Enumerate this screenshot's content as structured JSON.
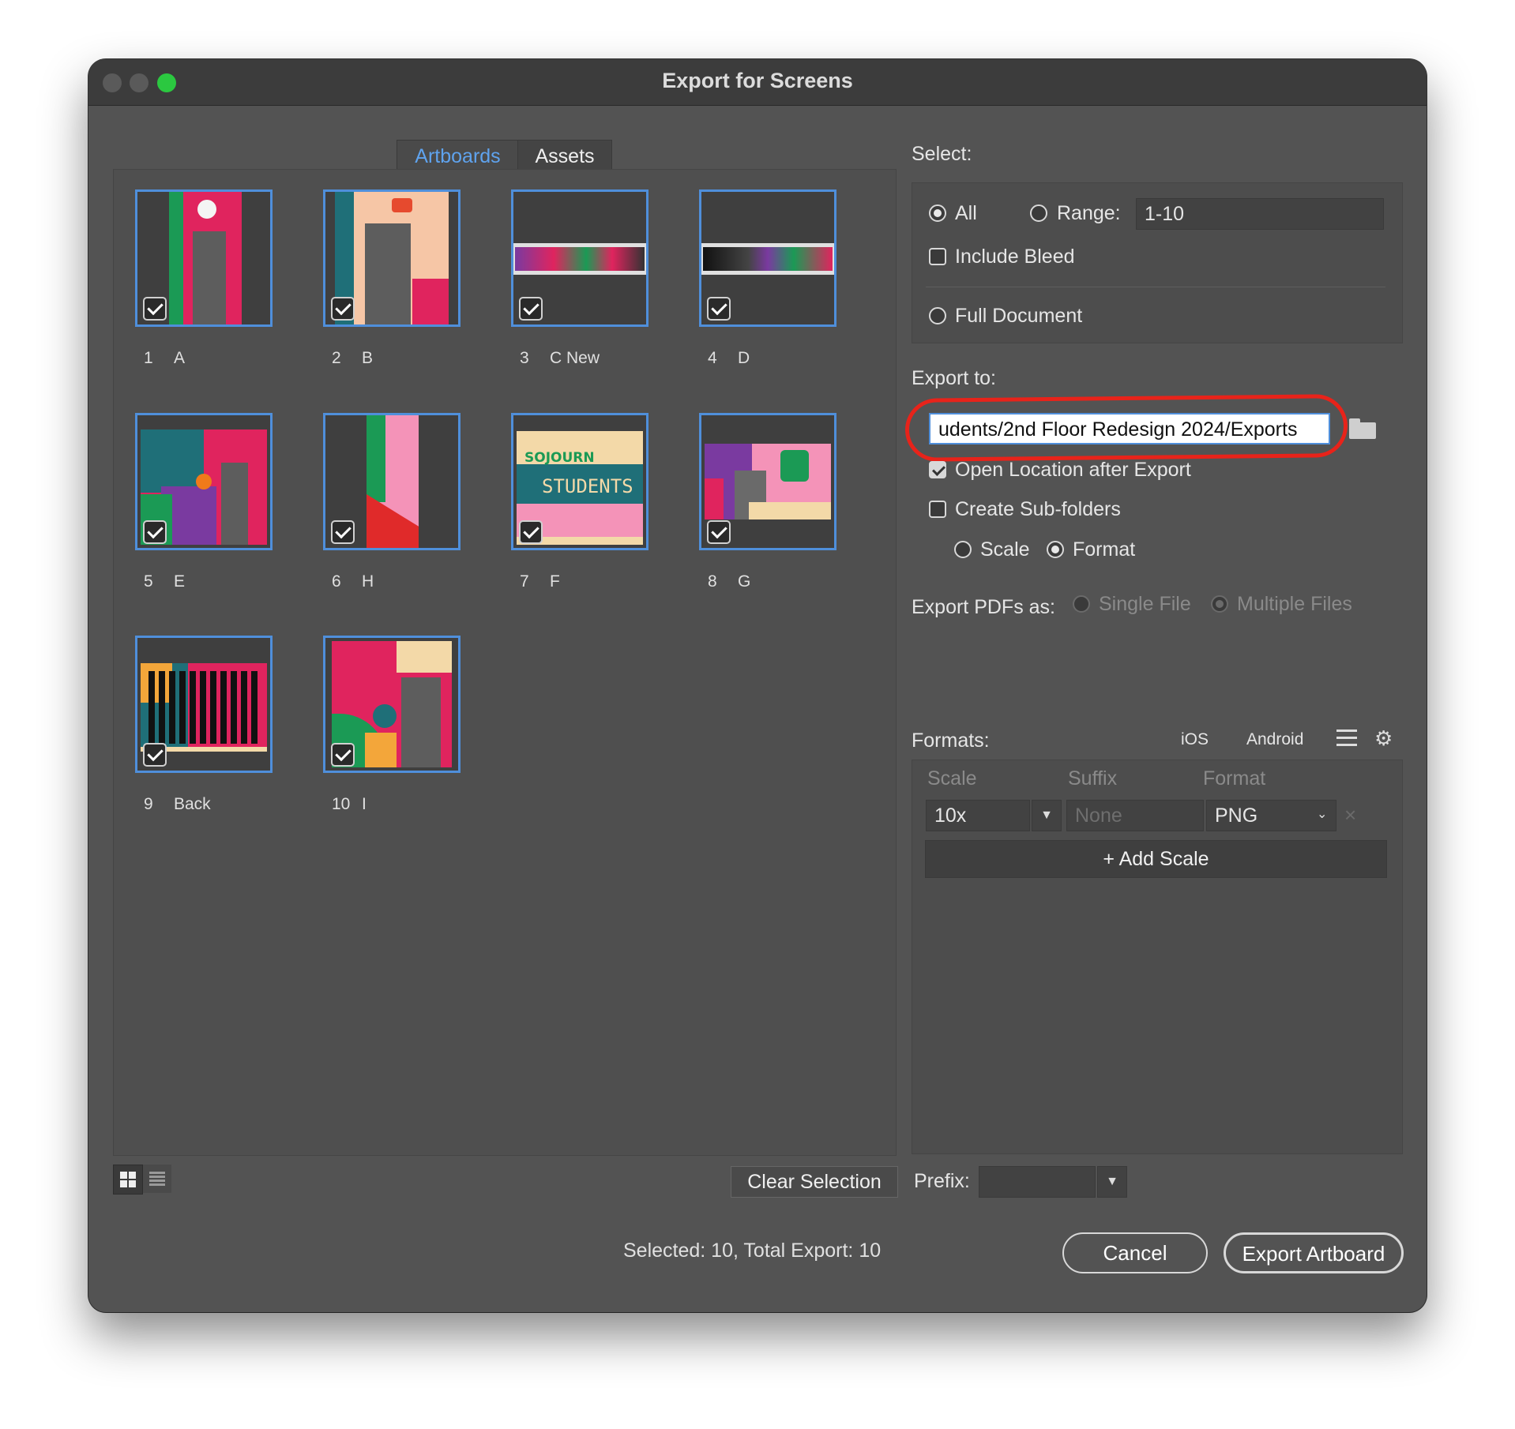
{
  "window": {
    "title": "Export for Screens",
    "traffic_lights": [
      "#5a5a5a",
      "#5a5a5a",
      "#2bc840"
    ]
  },
  "tabs": {
    "artboards": "Artboards",
    "assets": "Assets"
  },
  "artboards": [
    {
      "num": "1",
      "name": "A"
    },
    {
      "num": "2",
      "name": "B"
    },
    {
      "num": "3",
      "name": "C New"
    },
    {
      "num": "4",
      "name": "D"
    },
    {
      "num": "5",
      "name": "E"
    },
    {
      "num": "6",
      "name": "H"
    },
    {
      "num": "7",
      "name": "F",
      "art_text_1": "SOJOURN",
      "art_text_2": "STUDENTS"
    },
    {
      "num": "8",
      "name": "G"
    },
    {
      "num": "9",
      "name": "Back"
    },
    {
      "num": "10",
      "name": "I"
    }
  ],
  "select": {
    "label": "Select:",
    "all": "All",
    "range": "Range:",
    "range_value": "1-10",
    "include_bleed": "Include Bleed",
    "full_document": "Full Document"
  },
  "export_to": {
    "label": "Export to:",
    "path": "udents/2nd Floor Redesign 2024/Exports",
    "open_location": "Open Location after Export",
    "sub_folders": "Create Sub-folders",
    "scale": "Scale",
    "format": "Format"
  },
  "pdf": {
    "label": "Export PDFs as:",
    "single": "Single File",
    "multiple": "Multiple Files"
  },
  "formats": {
    "label": "Formats:",
    "ios": "iOS",
    "android": "Android",
    "col_scale": "Scale",
    "col_suffix": "Suffix",
    "col_format": "Format",
    "scale_value": "10x",
    "suffix_placeholder": "None",
    "format_value": "PNG",
    "add_scale": "Add Scale"
  },
  "footer": {
    "clear_selection": "Clear Selection",
    "prefix": "Prefix:",
    "status": "Selected: 10, Total Export: 10",
    "cancel": "Cancel",
    "export": "Export Artboard"
  },
  "colors": {
    "accent": "#4f8fdb",
    "tab_active": "#5fa3ee",
    "annotation": "#e8231a"
  }
}
